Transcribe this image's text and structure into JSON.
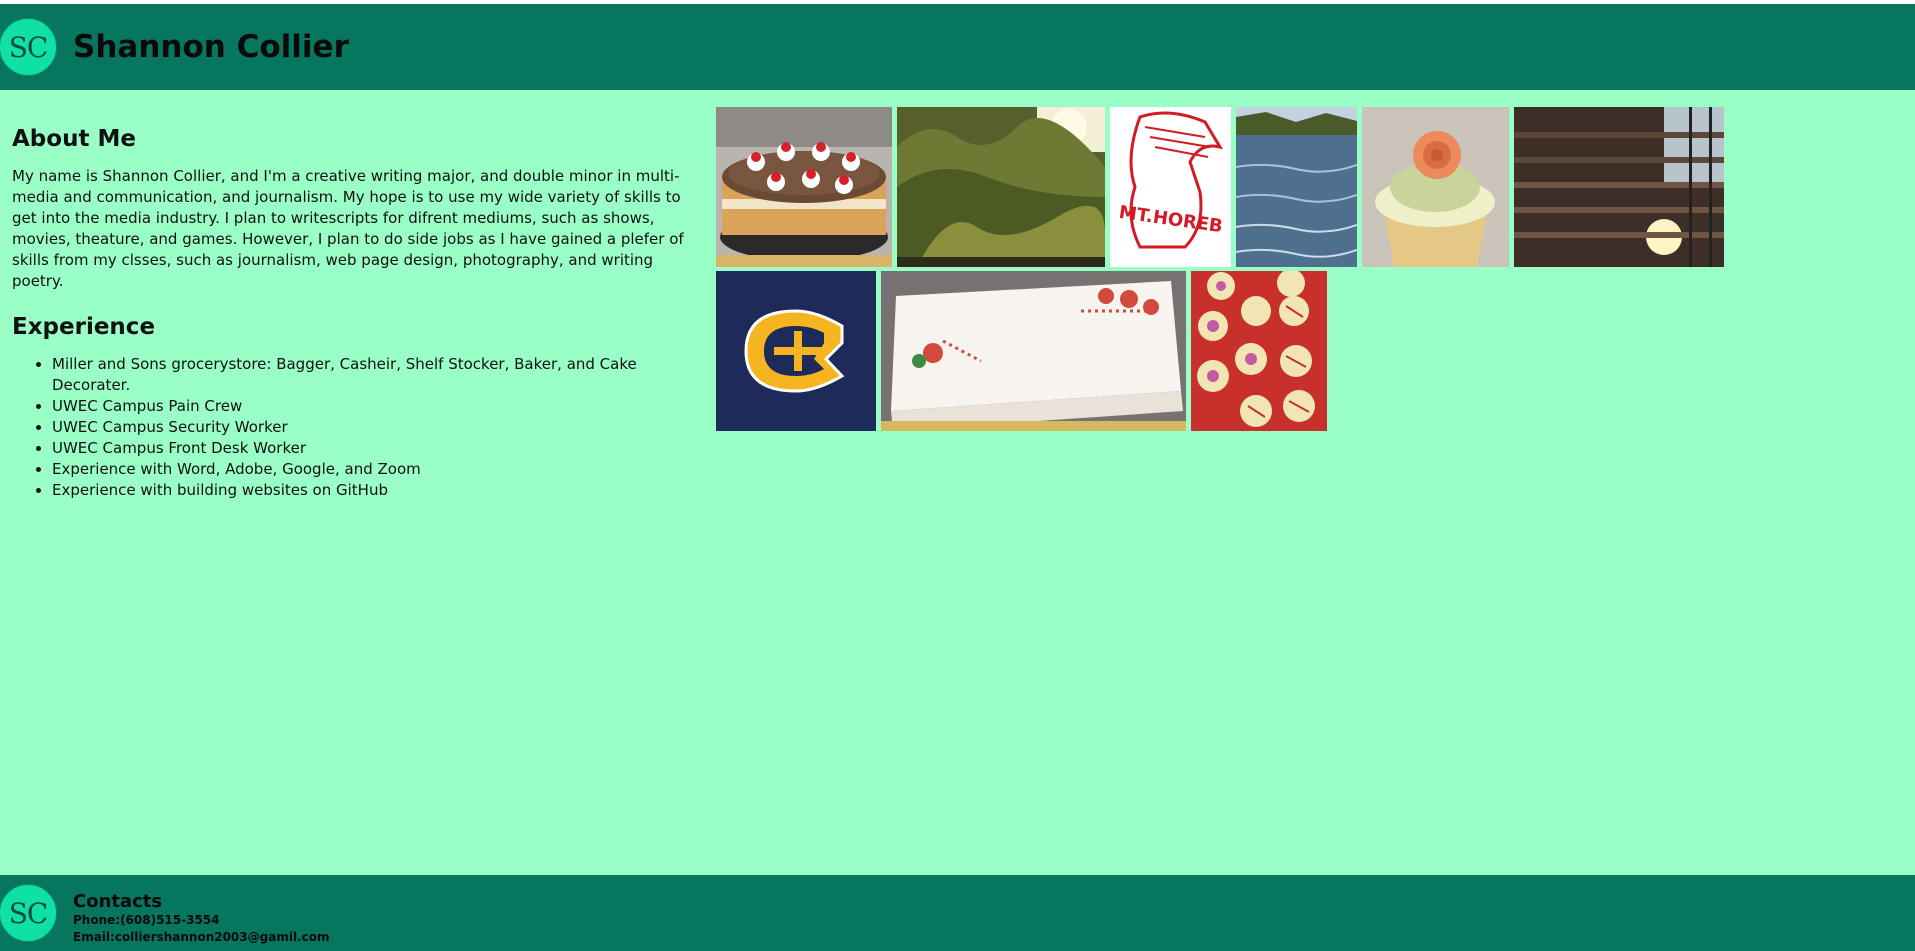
{
  "header": {
    "logo_text": "SC",
    "title": "Shannon Collier"
  },
  "about": {
    "heading": "About Me",
    "text": "My name is Shannon Collier, and I'm a creative writing major, and double minor in multi-media and communication, and journalism. My hope is to use my wide variety of skills to get into the media industry. I plan to writescripts for difrent mediums, such as shows, movies, theature, and games. However, I plan to do side jobs as I have gained a plefer of skills from my clsses, such as journalism, web page design, photography, and writing poetry."
  },
  "experience": {
    "heading": "Experience",
    "items": [
      "Miller and Sons grocerystore: Bagger, Casheir, Shelf Stocker, Baker, and Cake Decorater.",
      "UWEC Campus Pain Crew",
      "UWEC Campus Security Worker",
      "UWEC Campus Front Desk Worker",
      "Experience with Word, Adobe, Google, and Zoom",
      "Experience with building websites on GitHub"
    ]
  },
  "gallery": {
    "row1": [
      "cake-photo",
      "shrub-photo",
      "mt-horeb-logo",
      "river-photo",
      "cupcake-photo",
      "sunset-structure-photo"
    ],
    "row2": [
      "uwec-logo",
      "sheet-cake-photo",
      "cookies-photo"
    ],
    "mt_horeb_text": "MT.HOREB"
  },
  "footer": {
    "logo_text": "SC",
    "title": "Contacts",
    "phone": "Phone:(608)515-3554",
    "email": "Email:colliershannon2003@gamil.com"
  },
  "colors": {
    "page_bg": "#99ffc6",
    "bar_bg": "#06765f",
    "logo_bg": "#0ee0a6"
  }
}
